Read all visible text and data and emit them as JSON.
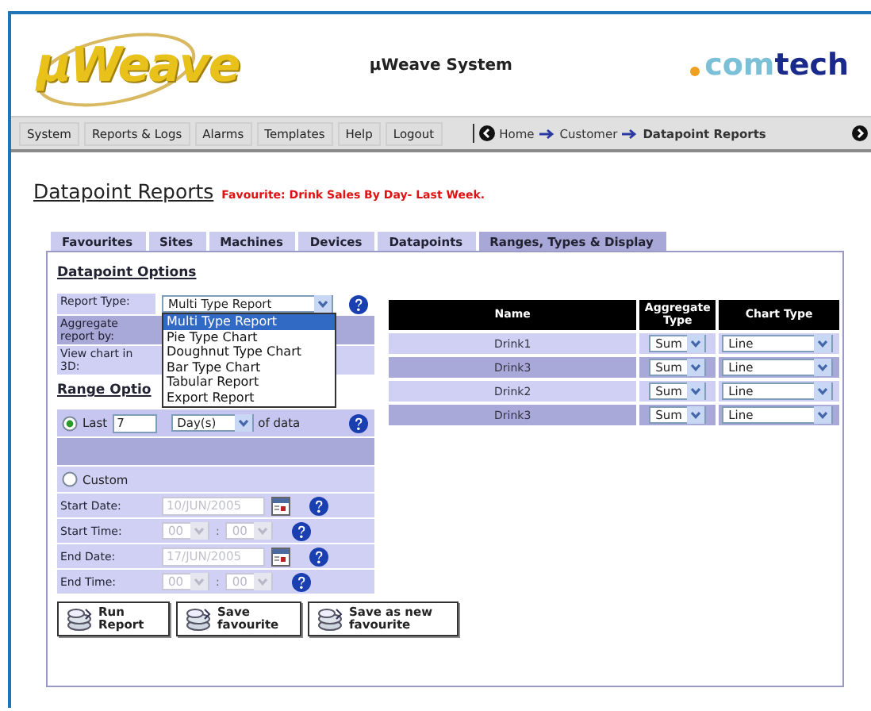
{
  "header": {
    "logo": "µWeave",
    "title": "µWeave System",
    "brand": [
      "com",
      "tech"
    ]
  },
  "nav": {
    "items": [
      "System",
      "Reports & Logs",
      "Alarms",
      "Templates",
      "Help",
      "Logout"
    ],
    "breadcrumb": [
      "Home",
      "Customer",
      "Datapoint Reports"
    ]
  },
  "page": {
    "title": "Datapoint Reports",
    "favourite": "Favourite: Drink Sales By Day- Last Week."
  },
  "tabs": [
    {
      "label": "Favourites",
      "selected": false
    },
    {
      "label": "Sites",
      "selected": false
    },
    {
      "label": "Machines",
      "selected": false
    },
    {
      "label": "Devices",
      "selected": false
    },
    {
      "label": "Datapoints",
      "selected": false
    },
    {
      "label": "Ranges, Types & Display",
      "selected": true
    }
  ],
  "datapoint_options": {
    "heading": "Datapoint Options",
    "report_type_label": "Report Type:",
    "report_type": "Multi Type Report",
    "expanded": true,
    "options": [
      {
        "label": "Multi Type Report",
        "selected": true
      },
      {
        "label": "Pie Type Chart",
        "selected": false
      },
      {
        "label": "Doughnut Type Chart",
        "selected": false
      },
      {
        "label": "Bar Type Chart",
        "selected": false
      },
      {
        "label": "Tabular Report",
        "selected": false
      },
      {
        "label": "Export Report",
        "selected": false
      }
    ],
    "aggregate_label": "Aggregate report by:",
    "view_3d_label": "View chart in 3D:"
  },
  "range_options": {
    "heading": "Range Optio",
    "time_separator": ":",
    "last": {
      "selected": true,
      "label": "Last",
      "value": "7",
      "unit": "Day(s)",
      "suffix": "of data"
    },
    "custom": {
      "selected": false,
      "label": "Custom"
    },
    "fields": [
      {
        "kind": "date",
        "label": "Start Date:",
        "value": "10/JUN/2005",
        "disabled": true
      },
      {
        "kind": "time",
        "label": "Start Time:",
        "hours": "00",
        "minutes": "00",
        "disabled": true
      },
      {
        "kind": "date",
        "label": "End Date:",
        "value": "17/JUN/2005",
        "disabled": true
      },
      {
        "kind": "time",
        "label": "End Time:",
        "hours": "00",
        "minutes": "00",
        "disabled": true
      }
    ]
  },
  "buttons": [
    "Run Report",
    "Save favourite",
    "Save as new favourite"
  ],
  "table": {
    "columns": [
      "Name",
      "Aggregate Type",
      "Chart Type"
    ],
    "rows": [
      {
        "name": "Drink1",
        "aggregate": "Sum",
        "chart": "Line"
      },
      {
        "name": "Drink3",
        "aggregate": "Sum",
        "chart": "Line"
      },
      {
        "name": "Drink2",
        "aggregate": "Sum",
        "chart": "Line"
      },
      {
        "name": "Drink3",
        "aggregate": "Sum",
        "chart": "Line"
      }
    ]
  }
}
